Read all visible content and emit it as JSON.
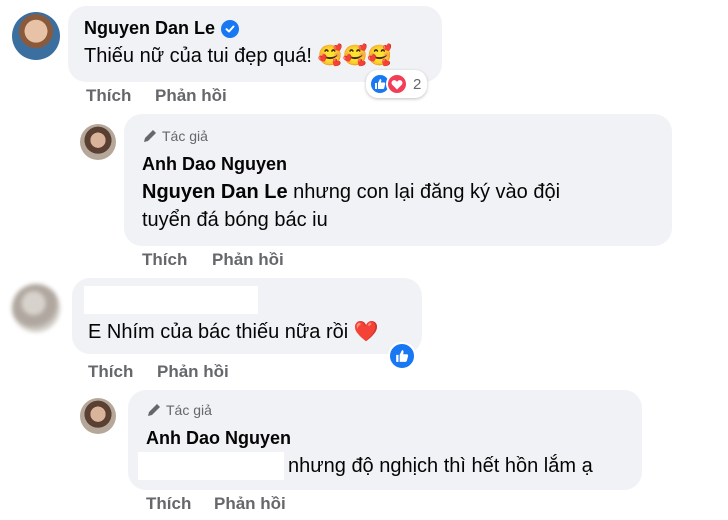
{
  "comments": [
    {
      "author": "Nguyen Dan Le",
      "text": "Thiếu nữ của tui đẹp quá! 🥰🥰🥰",
      "reactions_count": "2",
      "actions": {
        "like": "Thích",
        "reply": "Phản hồi"
      },
      "reply": {
        "author_tag": "Tác giả",
        "author": "Anh Dao Nguyen",
        "mention": "Nguyen Dan Le",
        "text_line1": "nhưng con lại đăng ký vào đội",
        "text_line2": "tuyển đá bóng bác iu",
        "actions": {
          "like": "Thích",
          "reply": "Phản hồi"
        }
      }
    },
    {
      "author": "",
      "text": "E Nhím của bác thiếu nữa rồi ❤️",
      "actions": {
        "like": "Thích",
        "reply": "Phản hồi"
      },
      "reply": {
        "author_tag": "Tác giả",
        "author": "Anh Dao Nguyen",
        "text": "nhưng độ nghịch thì hết hồn lắm ạ",
        "actions": {
          "like": "Thích",
          "reply": "Phản hồi"
        }
      }
    }
  ],
  "colors": {
    "bubble": "#f0f2f5",
    "secondary_text": "#65676b",
    "like_blue": "#1877f2",
    "love_red": "#f33e58"
  }
}
